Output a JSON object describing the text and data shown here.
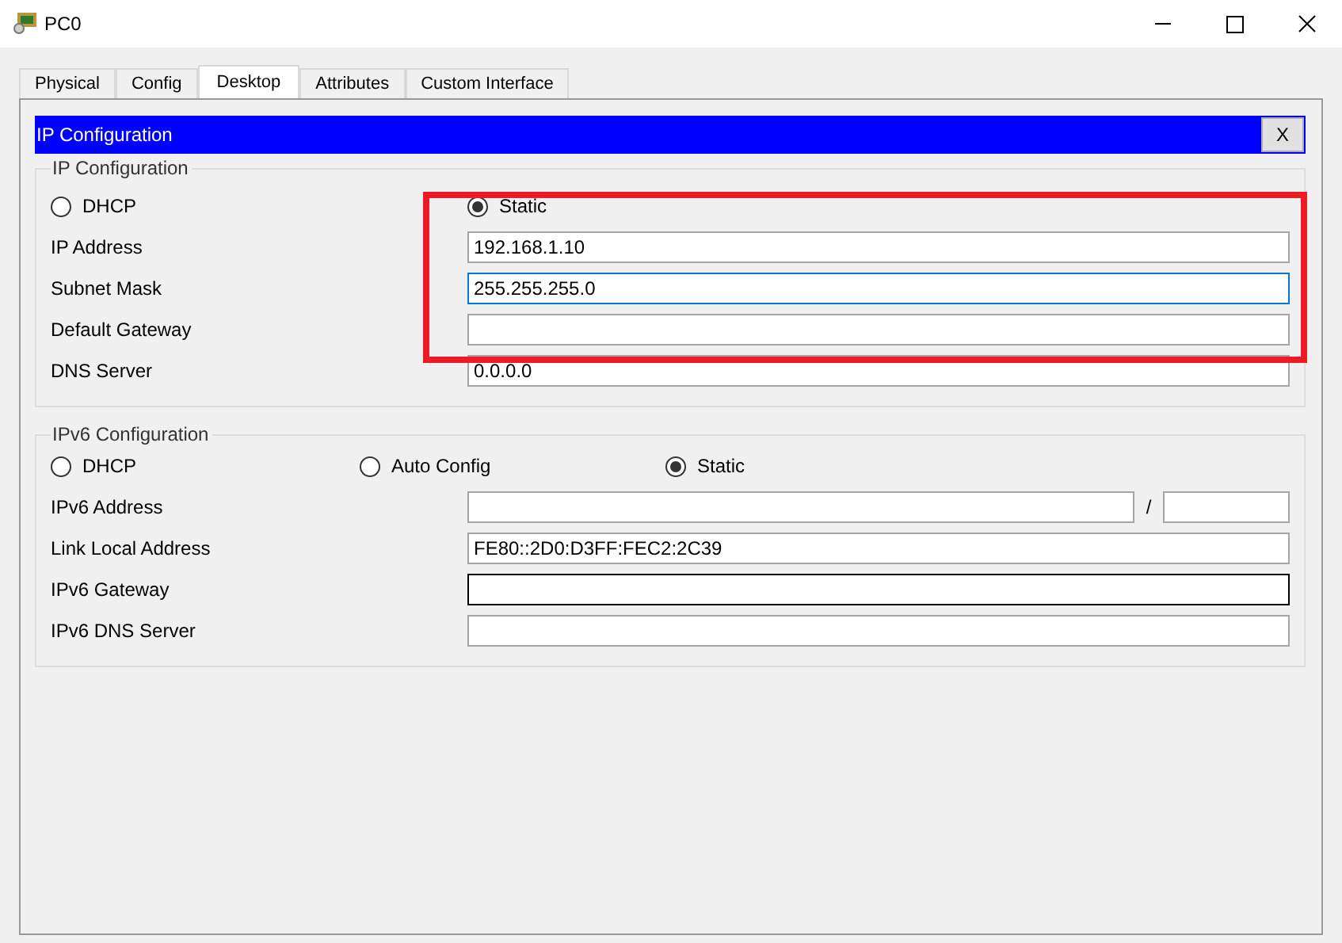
{
  "window": {
    "title": "PC0"
  },
  "tabs": [
    {
      "label": "Physical",
      "selected": false
    },
    {
      "label": "Config",
      "selected": false
    },
    {
      "label": "Desktop",
      "selected": true
    },
    {
      "label": "Attributes",
      "selected": false
    },
    {
      "label": "Custom Interface",
      "selected": false
    }
  ],
  "panel": {
    "title": "IP Configuration",
    "close": "X"
  },
  "ipv4": {
    "legend": "IP Configuration",
    "modes": [
      {
        "label": "DHCP",
        "selected": false
      },
      {
        "label": "Static",
        "selected": true
      }
    ],
    "fields": [
      {
        "label": "IP Address",
        "value": "192.168.1.10",
        "focused": false,
        "dark_border": false
      },
      {
        "label": "Subnet Mask",
        "value": "255.255.255.0",
        "focused": true,
        "dark_border": false
      },
      {
        "label": "Default Gateway",
        "focused": false,
        "dark_border": false
      },
      {
        "label": "DNS Server",
        "value": "0.0.0.0",
        "focused": false,
        "dark_border": false
      }
    ]
  },
  "ipv6": {
    "legend": "IPv6 Configuration",
    "modes": [
      {
        "label": "DHCP",
        "selected": false
      },
      {
        "label": "Auto Config",
        "selected": false
      },
      {
        "label": "Static",
        "selected": true
      }
    ],
    "fields": [
      {
        "label": "IPv6 Address",
        "focused": false,
        "dark_border": false,
        "separator": "/"
      },
      {
        "label": "Link Local Address",
        "value": "FE80::2D0:D3FF:FEC2:2C39",
        "focused": false,
        "dark_border": false
      },
      {
        "label": "IPv6 Gateway",
        "focused": false,
        "dark_border": true
      },
      {
        "label": "IPv6 DNS Server",
        "focused": false,
        "dark_border": false
      }
    ]
  },
  "highlight": {
    "kind": "rectangle"
  }
}
